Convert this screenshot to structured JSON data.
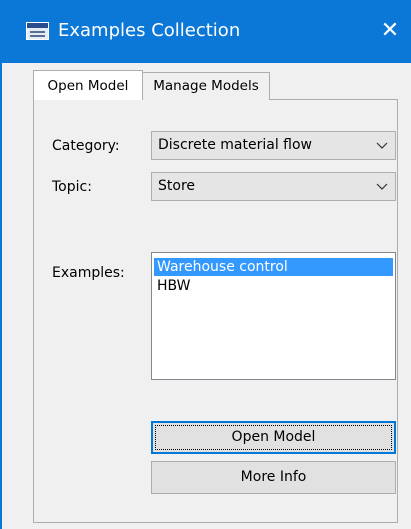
{
  "window": {
    "title": "Examples Collection",
    "close_icon": "close-icon",
    "accent_color": "#0b78d7"
  },
  "tabs": [
    {
      "label": "Open Model",
      "selected": true
    },
    {
      "label": "Manage Models",
      "selected": false
    }
  ],
  "form": {
    "category_label": "Category:",
    "category_value": "Discrete material flow",
    "topic_label": "Topic:",
    "topic_value": "Store",
    "examples_label": "Examples:",
    "examples": [
      {
        "label": "Warehouse control",
        "selected": true
      },
      {
        "label": "HBW",
        "selected": false
      }
    ]
  },
  "buttons": {
    "open_model": "Open Model",
    "more_info": "More Info"
  },
  "colors": {
    "selection": "#3399ff",
    "focus_border": "#0078d7"
  }
}
